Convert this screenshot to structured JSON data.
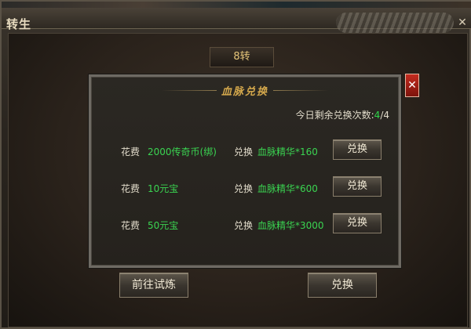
{
  "window": {
    "title": "转生",
    "close_glyph": "✕"
  },
  "stage_label": "8转",
  "bottom_buttons": {
    "left": "前往试炼",
    "right": "兑换"
  },
  "dialog": {
    "title": "血脉兑换",
    "close_glyph": "✕",
    "remaining_label": "今日剩余兑换次数:",
    "remaining_used": "4",
    "remaining_sep": "/",
    "remaining_total": "4",
    "rows": [
      {
        "cost_label": "花费",
        "cost_value": "2000传奇币(绑)",
        "exchange_label": "兑换",
        "reward": "血脉精华*160",
        "button": "兑换"
      },
      {
        "cost_label": "花费",
        "cost_value": "10元宝",
        "exchange_label": "兑换",
        "reward": "血脉精华*600",
        "button": "兑换"
      },
      {
        "cost_label": "花费",
        "cost_value": "50元宝",
        "exchange_label": "兑换",
        "reward": "血脉精华*3000",
        "button": "兑换"
      }
    ]
  },
  "colors": {
    "highlight_green": "#3ad451",
    "gold": "#d4a84c",
    "close_red": "#c32b1f"
  }
}
